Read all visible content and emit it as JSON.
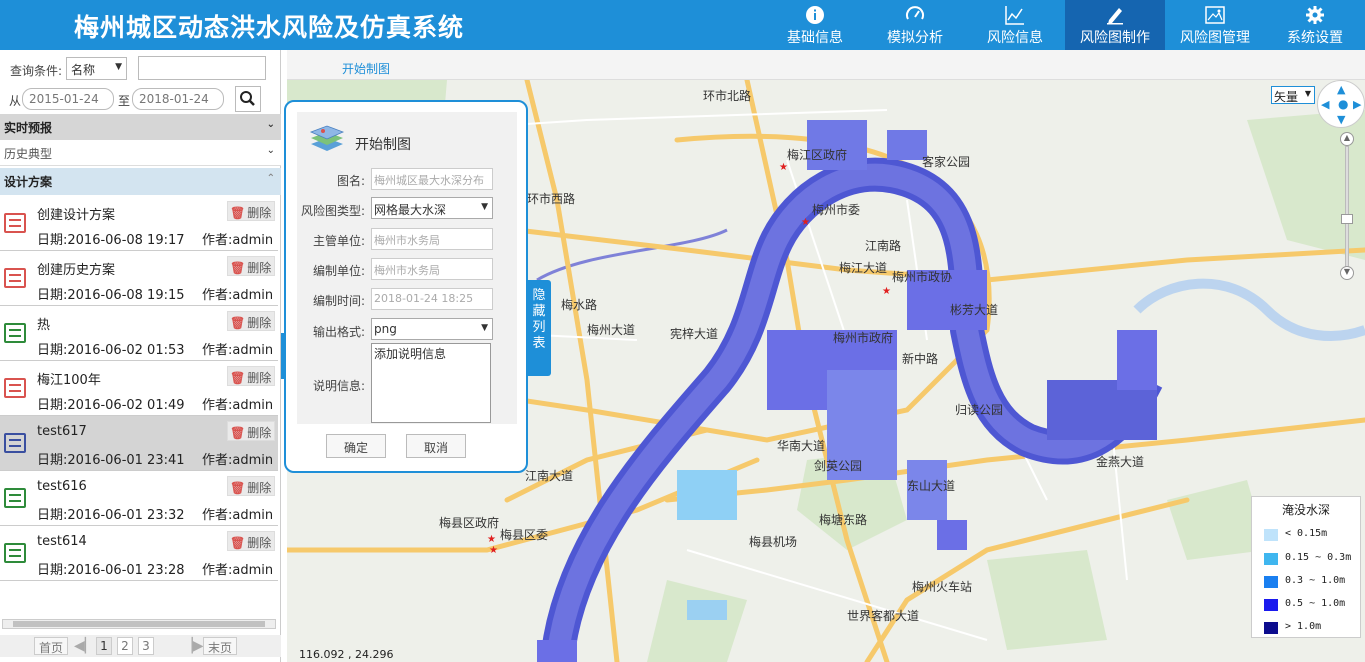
{
  "app": {
    "title": "梅州城区动态洪水风险及仿真系统"
  },
  "nav": [
    {
      "label": "基础信息",
      "icon": "info-icon",
      "active": false
    },
    {
      "label": "模拟分析",
      "icon": "gauge-icon",
      "active": false
    },
    {
      "label": "风险信息",
      "icon": "line-chart-icon",
      "active": false
    },
    {
      "label": "风险图制作",
      "icon": "pencil-icon",
      "active": true
    },
    {
      "label": "风险图管理",
      "icon": "image-icon",
      "active": false
    },
    {
      "label": "系统设置",
      "icon": "gear-icon",
      "active": false
    }
  ],
  "query": {
    "condition_label": "查询条件:",
    "condition_value": "名称",
    "keyword_value": "",
    "from_label": "从",
    "from_date": "2015-01-24",
    "to_label": "至",
    "to_date": "2018-01-24"
  },
  "sections": {
    "realtime": "实时预报",
    "history": "历史典型",
    "design": "设计方案"
  },
  "schemes": [
    {
      "name": "创建设计方案",
      "date": "日期:2016-06-08 19:17",
      "author": "作者:admin",
      "icon_color": "red",
      "selected": false
    },
    {
      "name": "创建历史方案",
      "date": "日期:2016-06-08 19:15",
      "author": "作者:admin",
      "icon_color": "red",
      "selected": false
    },
    {
      "name": "热",
      "date": "日期:2016-06-02 01:53",
      "author": "作者:admin",
      "icon_color": "green",
      "selected": false
    },
    {
      "name": "梅江100年",
      "date": "日期:2016-06-02 01:49",
      "author": "作者:admin",
      "icon_color": "red",
      "selected": false
    },
    {
      "name": "test617",
      "date": "日期:2016-06-01 23:41",
      "author": "作者:admin",
      "icon_color": "blue",
      "selected": true
    },
    {
      "name": "test616",
      "date": "日期:2016-06-01 23:32",
      "author": "作者:admin",
      "icon_color": "green",
      "selected": false
    },
    {
      "name": "test614",
      "date": "日期:2016-06-01 23:28",
      "author": "作者:admin",
      "icon_color": "green",
      "selected": false
    }
  ],
  "delete_label": "删除",
  "pager": {
    "first": "首页",
    "last": "末页",
    "pages": [
      "1",
      "2",
      "3"
    ],
    "current": "1"
  },
  "map": {
    "tab_label": "开始制图",
    "layer_value": "矢量",
    "coords": "116.092 , 24.296",
    "labels": [
      "梅江区政府",
      "梅州市委",
      "江南路",
      "梅州市政协",
      "梅州市政府",
      "客家公园",
      "归读公园",
      "剑英公园",
      "梅县区政府",
      "梅县区委",
      "梅县机场",
      "梅州火车站",
      "金燕大道",
      "梅塘东路",
      "华南大道",
      "新中路",
      "彬芳大道",
      "梅水路",
      "梅州大道",
      "环市西路",
      "环市北路",
      "梅江大道",
      "江南大道",
      "世界客都大道",
      "宪梓大道",
      "东山大道"
    ],
    "hide_tab": "隐藏列表"
  },
  "legend": {
    "title": "淹没水深",
    "items": [
      {
        "label": "< 0.15m",
        "color": "#bfe3fb"
      },
      {
        "label": "0.15 ~ 0.3m",
        "color": "#3fb6ef"
      },
      {
        "label": "0.3 ~ 1.0m",
        "color": "#1a7ff0"
      },
      {
        "label": "0.5 ~ 1.0m",
        "color": "#1a1aee"
      },
      {
        "label": "> 1.0m",
        "color": "#0c0c8e"
      }
    ]
  },
  "dialog": {
    "title": "开始制图",
    "fields": {
      "map_name_label": "图名:",
      "map_name_value": "梅州城区最大水深分布",
      "map_type_label": "风险图类型:",
      "map_type_value": "网格最大水深",
      "authority_label": "主管单位:",
      "authority_value": "梅州市水务局",
      "compiler_label": "编制单位:",
      "compiler_value": "梅州市水务局",
      "time_label": "编制时间:",
      "time_value": "2018-01-24 18:25",
      "format_label": "输出格式:",
      "format_value": "png",
      "desc_label": "说明信息:",
      "desc_value": "添加说明信息"
    },
    "ok_label": "确定",
    "cancel_label": "取消"
  }
}
